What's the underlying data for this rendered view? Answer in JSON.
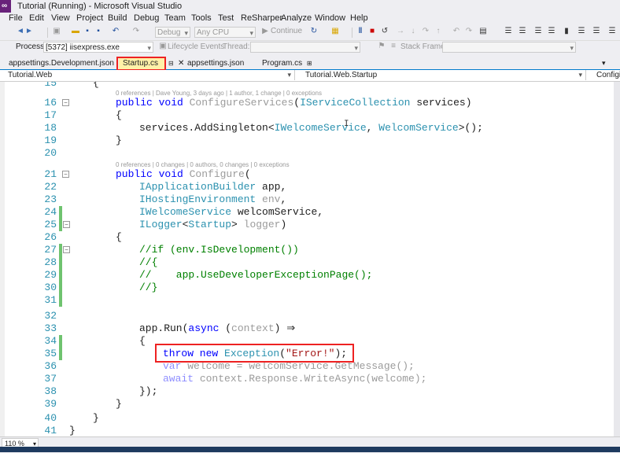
{
  "window": {
    "title": "Tutorial (Running) - Microsoft Visual Studio"
  },
  "menu": [
    "File",
    "Edit",
    "View",
    "Project",
    "Build",
    "Debug",
    "Team",
    "Tools",
    "Test",
    "ReSharper",
    "Analyze",
    "Window",
    "Help"
  ],
  "toolbar": {
    "config": "Debug",
    "platform": "Any CPU",
    "continue_label": "Continue"
  },
  "debug_bar": {
    "process_label": "Process:",
    "process_value": "[5372] iisexpress.exe",
    "lifecycle_label": "Lifecycle Events",
    "thread_label": "Thread:",
    "stackframe_label": "Stack Frame:"
  },
  "tabs": [
    {
      "label": "appsettings.Development.json"
    },
    {
      "label": "Startup.cs",
      "active": true,
      "pin": "⊞",
      "close": "✕"
    },
    {
      "label": "appsettings.json"
    },
    {
      "label": "Program.cs",
      "pin": "⊞"
    }
  ],
  "navbar": {
    "project": "Tutorial.Web",
    "class": "Tutorial.Web.Startup",
    "member": "Configi"
  },
  "codelens": {
    "configure_services": "0 references | Dave Young, 3 days ago | 1 author, 1 change | 0 exceptions",
    "configure": "0 references | 0 changes | 0 authors, 0 changes | 0 exceptions"
  },
  "lines": [
    {
      "n": "15",
      "t": "{"
    },
    {
      "n": "16",
      "t": "public void ConfigureServices(IServiceCollection services)"
    },
    {
      "n": "17",
      "t": "{"
    },
    {
      "n": "18",
      "t": "services.AddSingleton<IWelcomeService, WelcomService>();"
    },
    {
      "n": "19",
      "t": "}"
    },
    {
      "n": "20",
      "t": ""
    },
    {
      "n": "21",
      "t": "public void Configure("
    },
    {
      "n": "22",
      "t": "IApplicationBuilder app,"
    },
    {
      "n": "23",
      "t": "IHostingEnvironment env,"
    },
    {
      "n": "24",
      "t": "IWelcomeService welcomService,"
    },
    {
      "n": "25",
      "t": "ILogger<Startup> logger)"
    },
    {
      "n": "26",
      "t": "{"
    },
    {
      "n": "27",
      "t": "//if (env.IsDevelopment())"
    },
    {
      "n": "28",
      "t": "//{"
    },
    {
      "n": "29",
      "t": "//    app.UseDeveloperExceptionPage();"
    },
    {
      "n": "30",
      "t": "//}"
    },
    {
      "n": "31",
      "t": ""
    },
    {
      "n": "32",
      "t": ""
    },
    {
      "n": "33",
      "t": "app.Run(async (context) ⇒"
    },
    {
      "n": "34",
      "t": "{"
    },
    {
      "n": "35",
      "t": "throw new Exception(\"Error!\");"
    },
    {
      "n": "36",
      "t": "var welcome = welcomService.GetMessage();"
    },
    {
      "n": "37",
      "t": "await context.Response.WriteAsync(welcome);"
    },
    {
      "n": "38",
      "t": "});"
    },
    {
      "n": "39",
      "t": "}"
    },
    {
      "n": "40",
      "t": "}"
    },
    {
      "n": "41",
      "t": "}"
    }
  ],
  "status": {
    "zoom": "110 %"
  },
  "colors": {
    "keyword": "#0000ff",
    "type": "#2b91af",
    "string": "#a31515",
    "comment": "#008000",
    "highlight": "#e22222",
    "changed": "#6fc36f"
  }
}
